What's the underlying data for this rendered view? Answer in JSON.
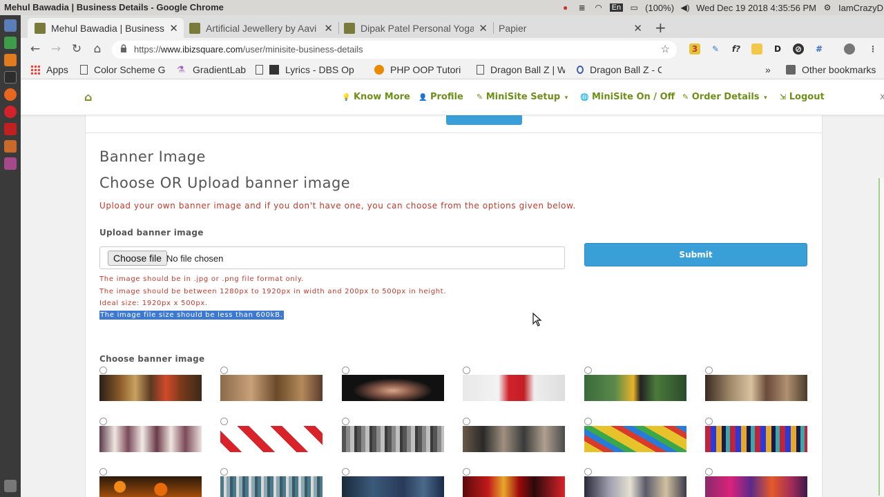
{
  "window": {
    "title": "Mehul Bawadia | Business Details - Google Chrome"
  },
  "system": {
    "lang": "En",
    "battery": "(100%)",
    "datetime": "Wed Dec 19 2018  4:35:56 PM",
    "user": "IamCrazyD"
  },
  "tabs": [
    {
      "title": "Mehul Bawadia | Business",
      "active": true
    },
    {
      "title": "Artificial Jewellery by Aavi",
      "active": false
    },
    {
      "title": "Dipak Patel Personal Yoga",
      "active": false
    },
    {
      "title": "Papier",
      "active": false
    }
  ],
  "toolbar": {
    "url_scheme": "https://",
    "url_host": "www.ibizsquare.com",
    "url_path": "/user/minisite-business-details"
  },
  "bookmarks": {
    "apps": "Apps",
    "items": [
      "Color Scheme G",
      "GradientLab",
      "Lyrics - DBS Op",
      "PHP OOP Tutori",
      "Dragon Ball Z | W",
      "Dragon Ball Z - C"
    ],
    "more": "»",
    "other": "Other bookmarks"
  },
  "sitenav": {
    "items": [
      {
        "label": "Know More",
        "icon": "lightbulb-icon",
        "glyph": "💡",
        "caret": ""
      },
      {
        "label": "Profile",
        "icon": "user-icon",
        "glyph": "👤",
        "caret": ""
      },
      {
        "label": "MiniSite Setup",
        "icon": "wrench-icon",
        "glyph": "✎",
        "caret": "▾"
      },
      {
        "label": "MiniSite On / Off",
        "icon": "globe-icon",
        "glyph": "🌐",
        "caret": ""
      },
      {
        "label": "Order Details",
        "icon": "wrench-icon",
        "glyph": "✎",
        "caret": "▾"
      },
      {
        "label": "Logout",
        "icon": "logout-icon",
        "glyph": "⇲",
        "caret": ""
      }
    ]
  },
  "content": {
    "heading": "Banner Image",
    "subheading": "Choose OR Upload banner image",
    "intro": "Upload your own banner image and if you don't have one, you can choose from the options given below.",
    "upload_label": "Upload banner image",
    "choose_file": "Choose file",
    "no_file": "No file chosen",
    "submit": "Submit",
    "rules": [
      "The image should be in .jpg or .png file format only.",
      "The image should be between 1280px to 1920px in width and 200px to 500px in height.",
      "Ideal size: 1920px x 500px.",
      "The image file size should be less than 600kB."
    ],
    "choose_label": "Choose banner image"
  },
  "colors": {
    "accent_green": "#6e8f1a",
    "error_red": "#c0392b",
    "primary_blue": "#3b9fd7",
    "selection": "#3d79d0"
  },
  "banners": [
    "perfume-bottles",
    "handbags-shop",
    "woman-necklace",
    "woman-red-sweater",
    "woman-yellow-dress",
    "market-hats",
    "wedding-dresses",
    "sale-tags",
    "clothes-rack",
    "clothing-store",
    "school-supplies",
    "colorful-fabrics",
    "marigold-flowers",
    "grocery-aisle",
    "denim-jeans",
    "red-bangles",
    "shopping-mall",
    "colorful-market"
  ]
}
